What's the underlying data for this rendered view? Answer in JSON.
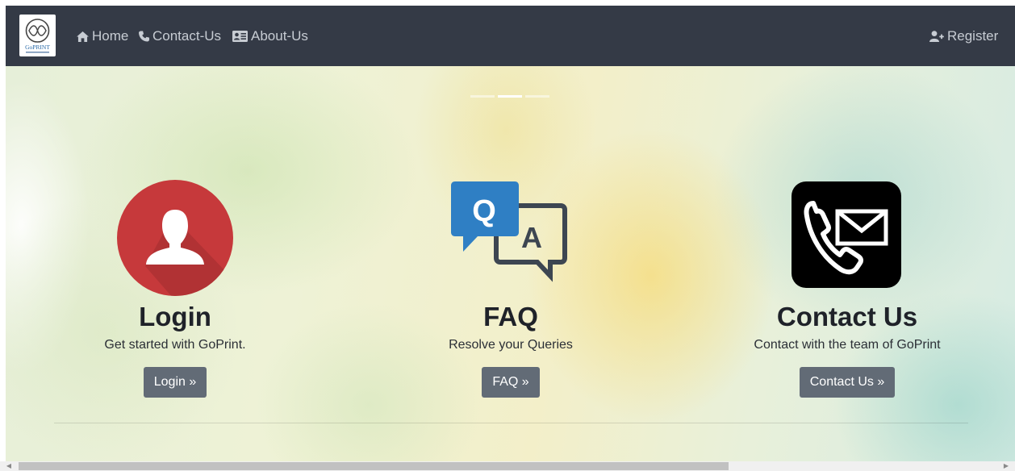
{
  "navbar": {
    "brand_alt": "GoPrint",
    "links": [
      {
        "label": "Home",
        "icon": "home-icon"
      },
      {
        "label": "Contact-Us",
        "icon": "phone-icon"
      },
      {
        "label": "About-Us",
        "icon": "id-card-icon"
      }
    ],
    "register": {
      "label": "Register",
      "icon": "user-plus-icon"
    }
  },
  "features": [
    {
      "title": "Login",
      "description": "Get started with GoPrint.",
      "button": "Login »",
      "icon": "user-avatar-icon"
    },
    {
      "title": "FAQ",
      "description": "Resolve your Queries",
      "button": "FAQ »",
      "icon": "question-answer-icon"
    },
    {
      "title": "Contact Us",
      "description": "Contact with the team of GoPrint",
      "button": "Contact Us »",
      "icon": "phone-mail-icon"
    }
  ],
  "colors": {
    "navbar_bg": "#343a46",
    "nav_text": "#c7ccd3",
    "button_bg": "#626b76",
    "login_red": "#c6393b",
    "faq_blue": "#2f7fc4",
    "faq_dark": "#3d4651"
  }
}
